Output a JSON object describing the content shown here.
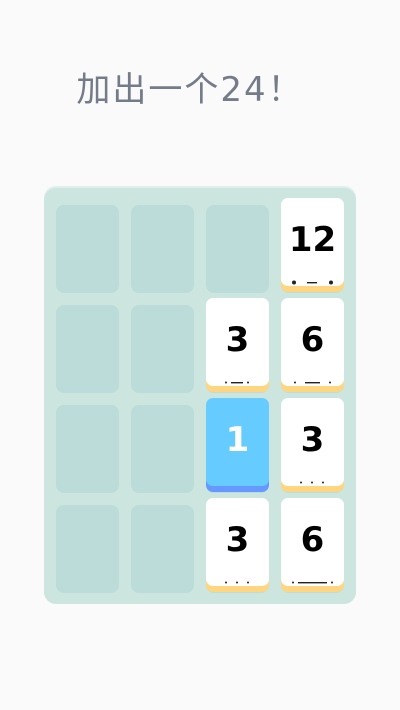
{
  "title": "加出一个24！",
  "colors": {
    "background": "#fafafa",
    "board": "#cce5de",
    "empty_cell": "#bbdcd9",
    "tile_white": "#ffffff",
    "tile_white_shadow": "#ffd67f",
    "tile_blue": "#66ccff",
    "tile_blue_shadow": "#6699ff",
    "title_text": "#757c89"
  },
  "board": {
    "rows": 4,
    "cols": 4,
    "tiles": [
      {
        "row": 0,
        "col": 3,
        "value": "12",
        "color": "white"
      },
      {
        "row": 1,
        "col": 2,
        "value": "3",
        "color": "white"
      },
      {
        "row": 1,
        "col": 3,
        "value": "6",
        "color": "white"
      },
      {
        "row": 2,
        "col": 2,
        "value": "1",
        "color": "blue"
      },
      {
        "row": 2,
        "col": 3,
        "value": "3",
        "color": "white"
      },
      {
        "row": 3,
        "col": 2,
        "value": "3",
        "color": "white"
      },
      {
        "row": 3,
        "col": 3,
        "value": "6",
        "color": "white"
      }
    ]
  }
}
